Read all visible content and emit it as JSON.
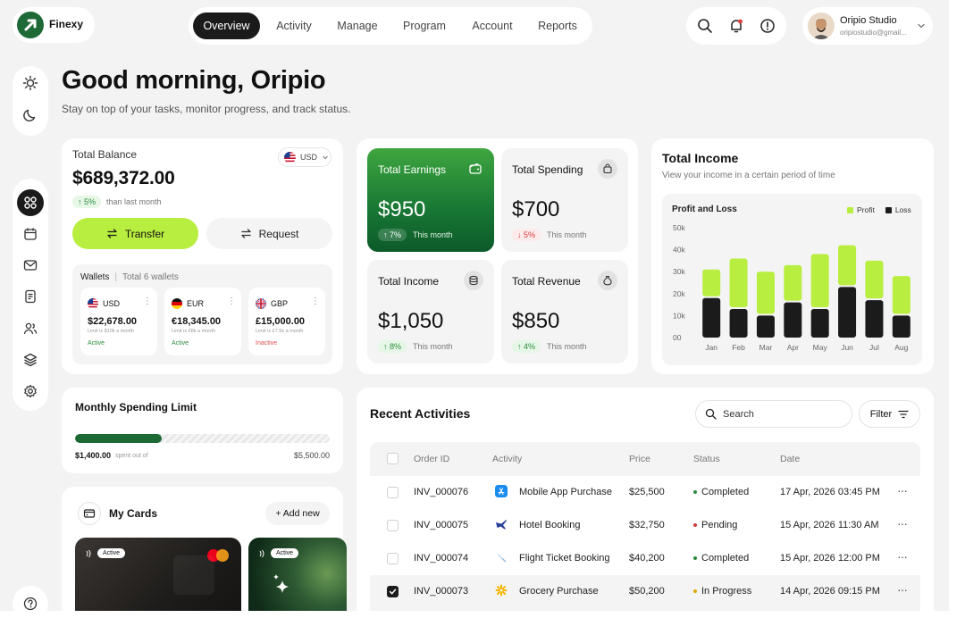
{
  "app": {
    "name": "Finexy"
  },
  "nav": {
    "items": [
      "Overview",
      "Activity",
      "Manage",
      "Program",
      "Account",
      "Reports"
    ],
    "active": "Overview"
  },
  "user": {
    "name": "Oripio Studio",
    "email": "oripiostudio@gmail..."
  },
  "greeting": {
    "title": "Good morning, Oripio",
    "subtitle": "Stay on top of your tasks, monitor progress, and track status."
  },
  "balance": {
    "label": "Total Balance",
    "currency": "USD",
    "amount": "$689,372.00",
    "change": "↑ 5%",
    "change_note": "than last month",
    "transfer_label": "Transfer",
    "request_label": "Request"
  },
  "wallets": {
    "title": "Wallets",
    "count": "Total 6 wallets",
    "items": [
      {
        "code": "USD",
        "amount": "$22,678.00",
        "limit": "Limit is $10k a month",
        "status": "Active"
      },
      {
        "code": "EUR",
        "amount": "€18,345.00",
        "limit": "Limit is €8k a month",
        "status": "Active"
      },
      {
        "code": "GBP",
        "amount": "£15,000.00",
        "limit": "Limit is £7.5k a month",
        "status": "Inactive"
      }
    ]
  },
  "stats": [
    {
      "label": "Total Earnings",
      "value": "$950",
      "change": "↑ 7%",
      "note": "This month"
    },
    {
      "label": "Total Spending",
      "value": "$700",
      "change": "↓ 5%",
      "note": "This month"
    },
    {
      "label": "Total Income",
      "value": "$1,050",
      "change": "↑ 8%",
      "note": "This month"
    },
    {
      "label": "Total Revenue",
      "value": "$850",
      "change": "↑ 4%",
      "note": "This month"
    }
  ],
  "income": {
    "title": "Total Income",
    "subtitle": "View your income in a certain period of time"
  },
  "chart_data": {
    "type": "bar",
    "title": "Profit and Loss",
    "stacked": true,
    "categories": [
      "Jan",
      "Feb",
      "Mar",
      "Apr",
      "May",
      "Jun",
      "Jul",
      "Aug"
    ],
    "series": [
      {
        "name": "Loss",
        "values": [
          18,
          13,
          10,
          16,
          13,
          23,
          17,
          10
        ],
        "color": "#1b1b1b"
      },
      {
        "name": "Profit",
        "values": [
          13,
          23,
          20,
          17,
          25,
          19,
          18,
          18
        ],
        "color": "#b8ee3f"
      }
    ],
    "yticks": [
      "00",
      "10k",
      "20k",
      "30k",
      "40k",
      "50k"
    ],
    "ylim": [
      0,
      50
    ],
    "legend": "top-right",
    "grid": false
  },
  "spending_limit": {
    "title": "Monthly Spending Limit",
    "spent": "$1,400.00",
    "spent_note": "spent out of",
    "limit": "$5,500.00",
    "progress": 0.34
  },
  "cards": {
    "title": "My Cards",
    "add_label": "+ Add new",
    "items": [
      {
        "status": "Active"
      },
      {
        "status": "Active"
      }
    ]
  },
  "activities": {
    "title": "Recent Activities",
    "search_placeholder": "Search",
    "filter_label": "Filter",
    "columns": [
      "Order ID",
      "Activity",
      "Price",
      "Status",
      "Date"
    ],
    "rows": [
      {
        "id": "INV_000076",
        "activity": "Mobile App Purchase",
        "price": "$25,500",
        "status": "Completed",
        "status_color": "#2c8a3a",
        "date": "17 Apr, 2026 03:45 PM",
        "checked": false,
        "icon": "app-store-icon"
      },
      {
        "id": "INV_000075",
        "activity": "Hotel Booking",
        "price": "$32,750",
        "status": "Pending",
        "status_color": "#d23c3c",
        "date": "15 Apr, 2026 11:30 AM",
        "checked": false,
        "icon": "hotel-icon"
      },
      {
        "id": "INV_000074",
        "activity": "Flight Ticket Booking",
        "price": "$40,200",
        "status": "Completed",
        "status_color": "#2c8a3a",
        "date": "15 Apr, 2026 12:00 PM",
        "checked": false,
        "icon": "plane-icon"
      },
      {
        "id": "INV_000073",
        "activity": "Grocery Purchase",
        "price": "$50,200",
        "status": "In Progress",
        "status_color": "#e0a800",
        "date": "14 Apr, 2026 09:15 PM",
        "checked": true,
        "icon": "grocery-icon"
      }
    ]
  }
}
